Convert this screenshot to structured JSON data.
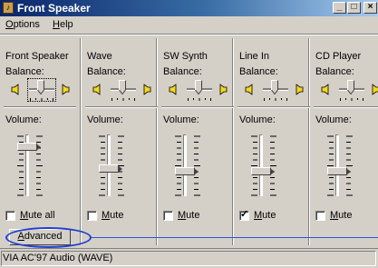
{
  "window": {
    "title": "Front Speaker",
    "icon_name": "volume-control-app-icon",
    "buttons": [
      {
        "name": "minimize",
        "glyph": "_"
      },
      {
        "name": "maximize",
        "glyph": "□"
      },
      {
        "name": "close",
        "glyph": "×"
      }
    ]
  },
  "menu": {
    "items": [
      {
        "label_mnemonic": "O",
        "label_rest": "ptions"
      },
      {
        "label_mnemonic": "H",
        "label_rest": "elp"
      }
    ]
  },
  "panels": [
    {
      "name": "Front Speaker",
      "balance_label": "Balance:",
      "volume_label": "Volume:",
      "mute_label": "Mute all",
      "mute_mnemonic_prefix": "",
      "mute_mnemonic": "M",
      "mute_rest": "ute all",
      "muted": false,
      "volume_fraction": 0.85,
      "balance_focused": true
    },
    {
      "name": "Wave",
      "balance_label": "Balance:",
      "volume_label": "Volume:",
      "mute_mnemonic": "M",
      "mute_rest": "ute",
      "muted": false,
      "volume_fraction": 0.45,
      "balance_focused": false
    },
    {
      "name": "SW Synth",
      "balance_label": "Balance:",
      "volume_label": "Volume:",
      "mute_mnemonic": "M",
      "mute_rest": "ute",
      "muted": false,
      "volume_fraction": 0.4,
      "balance_focused": false
    },
    {
      "name": "Line In",
      "balance_label": "Balance:",
      "volume_label": "Volume:",
      "mute_mnemonic": "M",
      "mute_rest": "ute",
      "muted": true,
      "volume_fraction": 0.4,
      "balance_focused": false
    },
    {
      "name": "CD Player",
      "balance_label": "Balance:",
      "volume_label": "Volume:",
      "mute_mnemonic": "M",
      "mute_rest": "ute",
      "muted": false,
      "volume_fraction": 0.4,
      "balance_focused": false
    }
  ],
  "advanced_button": {
    "mnemonic": "A",
    "rest": "dvanced"
  },
  "status": {
    "text": "VIA AC'97 Audio (WAVE)"
  },
  "colors": {
    "highlight_ellipse": "#1f3fd0",
    "callout_line": "#2b55e0",
    "title_gradient_start": "#0a246a"
  }
}
